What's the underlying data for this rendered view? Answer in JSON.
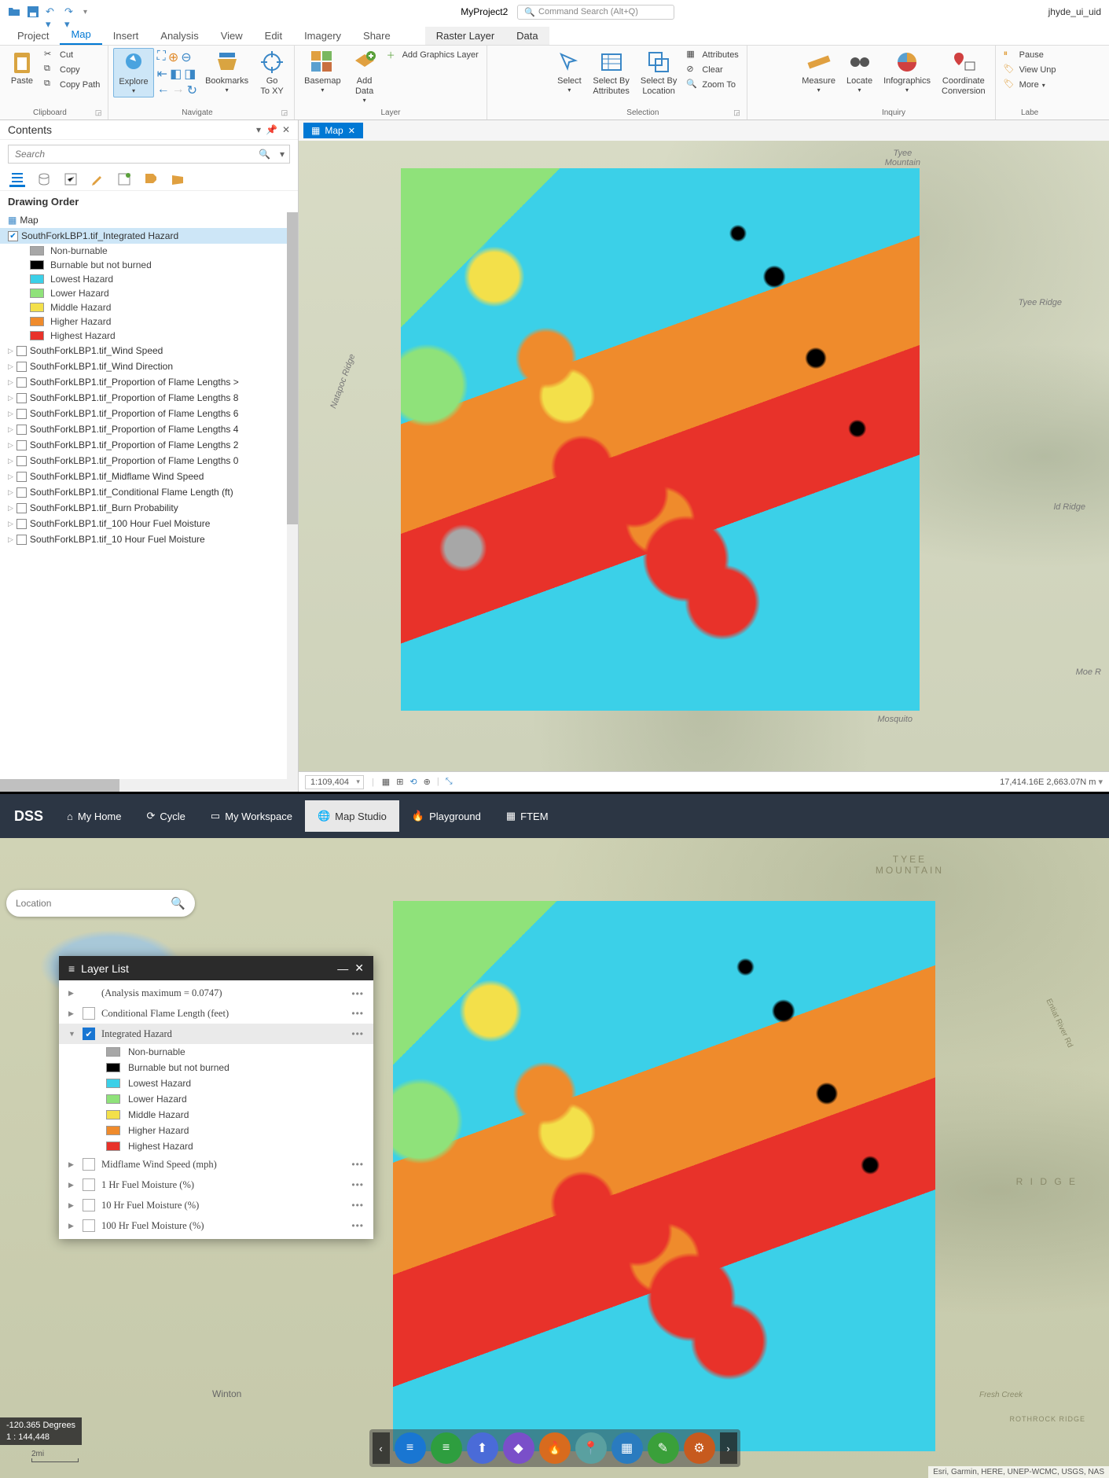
{
  "arc": {
    "project": "MyProject2",
    "cmd_search_placeholder": "Command Search (Alt+Q)",
    "user": "jhyde_ui_uid",
    "tabs": [
      "Project",
      "Map",
      "Insert",
      "Analysis",
      "View",
      "Edit",
      "Imagery",
      "Share"
    ],
    "context_tabs": [
      "Raster Layer",
      "Data"
    ],
    "active_tab": "Map",
    "clipboard": {
      "cut": "Cut",
      "copy": "Copy",
      "paste": "Paste",
      "copy_path": "Copy Path",
      "group": "Clipboard"
    },
    "navigate": {
      "explore": "Explore",
      "bookmarks": "Bookmarks",
      "goto": "Go\nTo XY",
      "group": "Navigate"
    },
    "layer": {
      "basemap": "Basemap",
      "adddata": "Add\nData",
      "addgraphics": "Add Graphics Layer",
      "group": "Layer"
    },
    "selection": {
      "select": "Select",
      "selby_attr": "Select By\nAttributes",
      "selby_loc": "Select By\nLocation",
      "attributes": "Attributes",
      "clear": "Clear",
      "zoomto": "Zoom To",
      "group": "Selection"
    },
    "inquiry": {
      "measure": "Measure",
      "locate": "Locate",
      "infographics": "Infographics",
      "coord": "Coordinate\nConversion",
      "group": "Inquiry"
    },
    "labeling": {
      "pause": "Pause",
      "viewunp": "View Unp",
      "more": "More",
      "group": "Labe"
    },
    "contents_title": "Contents",
    "search_placeholder": "Search",
    "drawing_order": "Drawing Order",
    "map_node": "Map",
    "active_layer": "SouthForkLBP1.tif_Integrated Hazard",
    "legend": [
      {
        "c": "#a7a7a7",
        "l": "Non-burnable"
      },
      {
        "c": "#000000",
        "l": "Burnable but not burned"
      },
      {
        "c": "#3bd0e8",
        "l": "Lowest Hazard"
      },
      {
        "c": "#8fe27a",
        "l": "Lower Hazard"
      },
      {
        "c": "#f3e04a",
        "l": "Middle Hazard"
      },
      {
        "c": "#ef8b2c",
        "l": "Higher Hazard"
      },
      {
        "c": "#e8322a",
        "l": "Highest Hazard"
      }
    ],
    "other_layers": [
      "SouthForkLBP1.tif_Wind Speed",
      "SouthForkLBP1.tif_Wind Direction",
      "SouthForkLBP1.tif_Proportion of Flame Lengths >",
      "SouthForkLBP1.tif_Proportion of Flame Lengths 8",
      "SouthForkLBP1.tif_Proportion of Flame Lengths 6",
      "SouthForkLBP1.tif_Proportion of Flame Lengths 4",
      "SouthForkLBP1.tif_Proportion of Flame Lengths 2",
      "SouthForkLBP1.tif_Proportion of Flame Lengths 0",
      "SouthForkLBP1.tif_Midflame Wind Speed",
      "SouthForkLBP1.tif_Conditional Flame Length (ft)",
      "SouthForkLBP1.tif_Burn Probability",
      "SouthForkLBP1.tif_100 Hour Fuel Moisture",
      "SouthForkLBP1.tif_10 Hour Fuel Moisture"
    ],
    "map_tab": "Map",
    "scale": "1:109,404",
    "coords": "17,414.16E 2,663.07N m",
    "terrain_labels": {
      "tyee": "Tyee\nMountain",
      "tyee_ridge": "Tyee Ridge",
      "ld_ridge": "ld Ridge",
      "mosquito": "Mosquito",
      "napoc": "Natapoc Ridge",
      "moe": "Moe R"
    }
  },
  "dss": {
    "logo": "DSS",
    "nav": [
      {
        "icon": "⌂",
        "l": "My Home"
      },
      {
        "icon": "⟳",
        "l": "Cycle"
      },
      {
        "icon": "▭",
        "l": "My Workspace"
      },
      {
        "icon": "🌐",
        "l": "Map Studio",
        "active": true
      },
      {
        "icon": "🔥",
        "l": "Playground"
      },
      {
        "icon": "▦",
        "l": "FTEM"
      }
    ],
    "loc_placeholder": "Location",
    "layer_list_title": "Layer List",
    "layers_top": [
      {
        "l": "(Analysis maximum = 0.0747)",
        "indent": true
      },
      {
        "l": "Conditional Flame Length (feet)"
      }
    ],
    "active_layer": "Integrated Hazard",
    "legend": [
      {
        "c": "#a7a7a7",
        "l": "Non-burnable"
      },
      {
        "c": "#000000",
        "l": "Burnable but not burned"
      },
      {
        "c": "#3bd0e8",
        "l": "Lowest Hazard"
      },
      {
        "c": "#8fe27a",
        "l": "Lower Hazard"
      },
      {
        "c": "#f3e04a",
        "l": "Middle Hazard"
      },
      {
        "c": "#ef8b2c",
        "l": "Higher Hazard"
      },
      {
        "c": "#e8322a",
        "l": "Highest Hazard"
      }
    ],
    "layers_bottom": [
      "Midflame Wind Speed (mph)",
      "1 Hr Fuel Moisture (%)",
      "10 Hr Fuel Moisture (%)",
      "100 Hr Fuel Moisture (%)"
    ],
    "coord_line1": "-120.365 Degrees",
    "coord_line2": "1 : 144,448",
    "scale_label": "2mi",
    "tools": [
      {
        "c": "#1976d2",
        "i": "≡"
      },
      {
        "c": "#2e9e3f",
        "i": "≡"
      },
      {
        "c": "#4a6bd8",
        "i": "⬆"
      },
      {
        "c": "#7a4fc9",
        "i": "◆"
      },
      {
        "c": "#d86b1e",
        "i": "🔥"
      },
      {
        "c": "#5aa0a0",
        "i": "📍"
      },
      {
        "c": "#2a7bbf",
        "i": "▦"
      },
      {
        "c": "#3aa03a",
        "i": "✎"
      },
      {
        "c": "#c75a1e",
        "i": "⚙"
      }
    ],
    "attribution": "Esri, Garmin, HERE, UNEP-WCMC, USGS, NAS",
    "terrain_labels": {
      "tyee": "TYEE\nMOUNTAIN",
      "ridge": "R I D G E",
      "winton": "Winton",
      "rothrock": "ROTHROCK RIDGE",
      "fresh": "Fresh Creek",
      "entiat": "Entiat River Rd"
    }
  }
}
